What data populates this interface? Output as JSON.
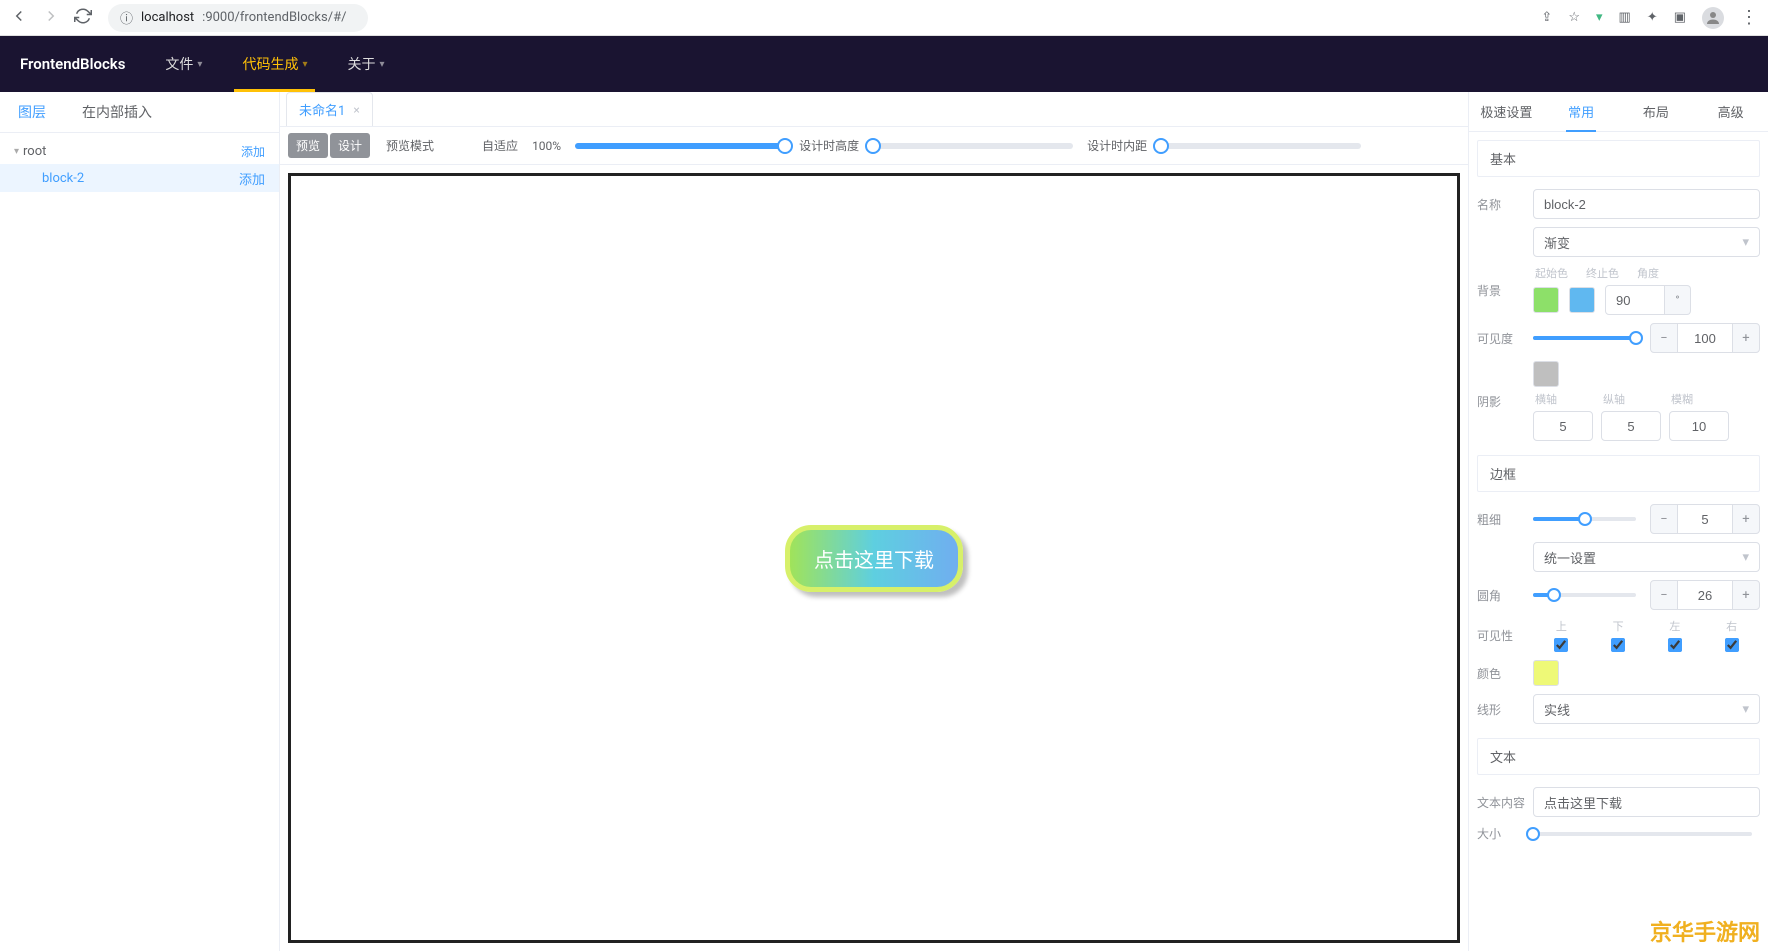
{
  "browser": {
    "url_host": "localhost",
    "url_rest": ":9000/frontendBlocks/#/"
  },
  "app": {
    "brand": "FrontendBlocks",
    "nav": [
      {
        "label": "文件",
        "has_caret": true,
        "active": false
      },
      {
        "label": "代码生成",
        "has_caret": true,
        "active": true
      },
      {
        "label": "关于",
        "has_caret": true,
        "active": false
      }
    ]
  },
  "left": {
    "tabs": [
      {
        "label": "图层",
        "active": true
      },
      {
        "label": "在内部插入",
        "active": false
      }
    ],
    "tree": {
      "root_label": "root",
      "add_label": "添加",
      "children": [
        {
          "label": "block-2",
          "selected": true
        }
      ]
    }
  },
  "center": {
    "tabs": [
      {
        "label": "未命名1"
      }
    ],
    "toolbar": {
      "preview_btn": "预览",
      "design_btn": "设计",
      "mode_label": "预览模式",
      "adaptive_label": "自适应",
      "zoom_value": "100%",
      "design_height_label": "设计时高度",
      "design_padding_label": "设计时内距"
    },
    "canvas": {
      "button_text": "点击这里下载"
    }
  },
  "right": {
    "tabs": [
      {
        "label": "极速设置",
        "active": false
      },
      {
        "label": "常用",
        "active": true
      },
      {
        "label": "布局",
        "active": false
      },
      {
        "label": "高级",
        "active": false
      }
    ],
    "sections": {
      "basic_header": "基本",
      "name_label": "名称",
      "name_value": "block-2",
      "bg_label": "背景",
      "bg_type_value": "渐变",
      "bg_sub_labels": {
        "start": "起始色",
        "end": "终止色",
        "angle": "角度"
      },
      "bg_angle_value": "90",
      "bg_angle_unit": "°",
      "bg_start_color": "#8de069",
      "bg_end_color": "#60b8f0",
      "visibility_label": "可见度",
      "visibility_value": "100",
      "shadow_label": "阴影",
      "shadow_color": "#bfbfbf",
      "shadow_sub_labels": {
        "x": "横轴",
        "y": "纵轴",
        "blur": "模糊"
      },
      "shadow_x": "5",
      "shadow_y": "5",
      "shadow_blur": "10",
      "border_header": "边框",
      "thickness_label": "粗细",
      "thickness_value": "5",
      "radius_label": "圆角",
      "radius_type": "统一设置",
      "radius_value": "26",
      "visible_sides_label": "可见性",
      "sides": {
        "top": "上",
        "bottom": "下",
        "left": "左",
        "right": "右"
      },
      "color_label": "颜色",
      "border_color": "#eef977",
      "line_style_label": "线形",
      "line_style_value": "实线",
      "text_header": "文本",
      "text_content_label": "文本内容",
      "text_content_value": "点击这里下载",
      "size_label": "大小"
    }
  },
  "watermark": "京华手游网"
}
